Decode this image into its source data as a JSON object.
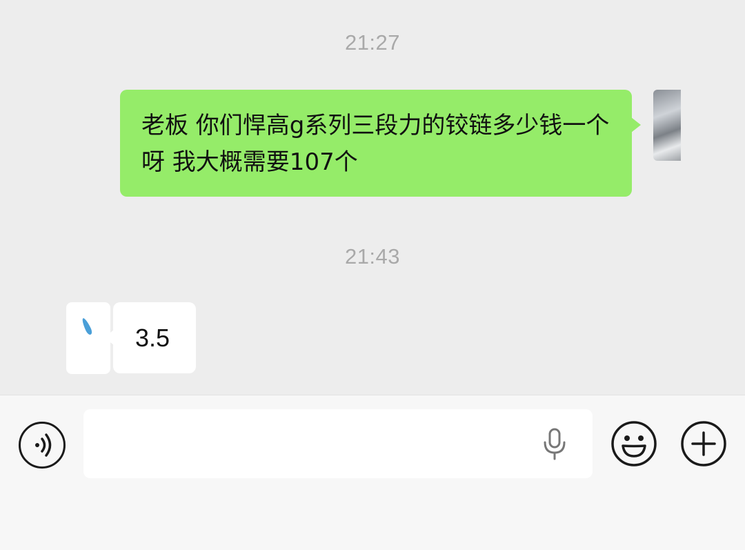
{
  "chat": {
    "messages": [
      {
        "type": "timestamp",
        "text": "21:27"
      },
      {
        "type": "outgoing",
        "text": "老板 你们悍高g系列三段力的铰链多少钱一个呀 我大概需要107个"
      },
      {
        "type": "timestamp",
        "text": "21:43"
      },
      {
        "type": "incoming",
        "text": "3.5"
      }
    ]
  },
  "input_bar": {
    "text_value": "",
    "icons": {
      "voice": "voice-mode-icon",
      "mic": "microphone-icon",
      "emoji": "emoji-icon",
      "plus": "plus-icon"
    }
  },
  "colors": {
    "background": "#ededed",
    "outgoing_bubble": "#95ec69",
    "incoming_bubble": "#ffffff",
    "timestamp_text": "#a9a9a9",
    "input_bar_bg": "#f7f7f7"
  }
}
